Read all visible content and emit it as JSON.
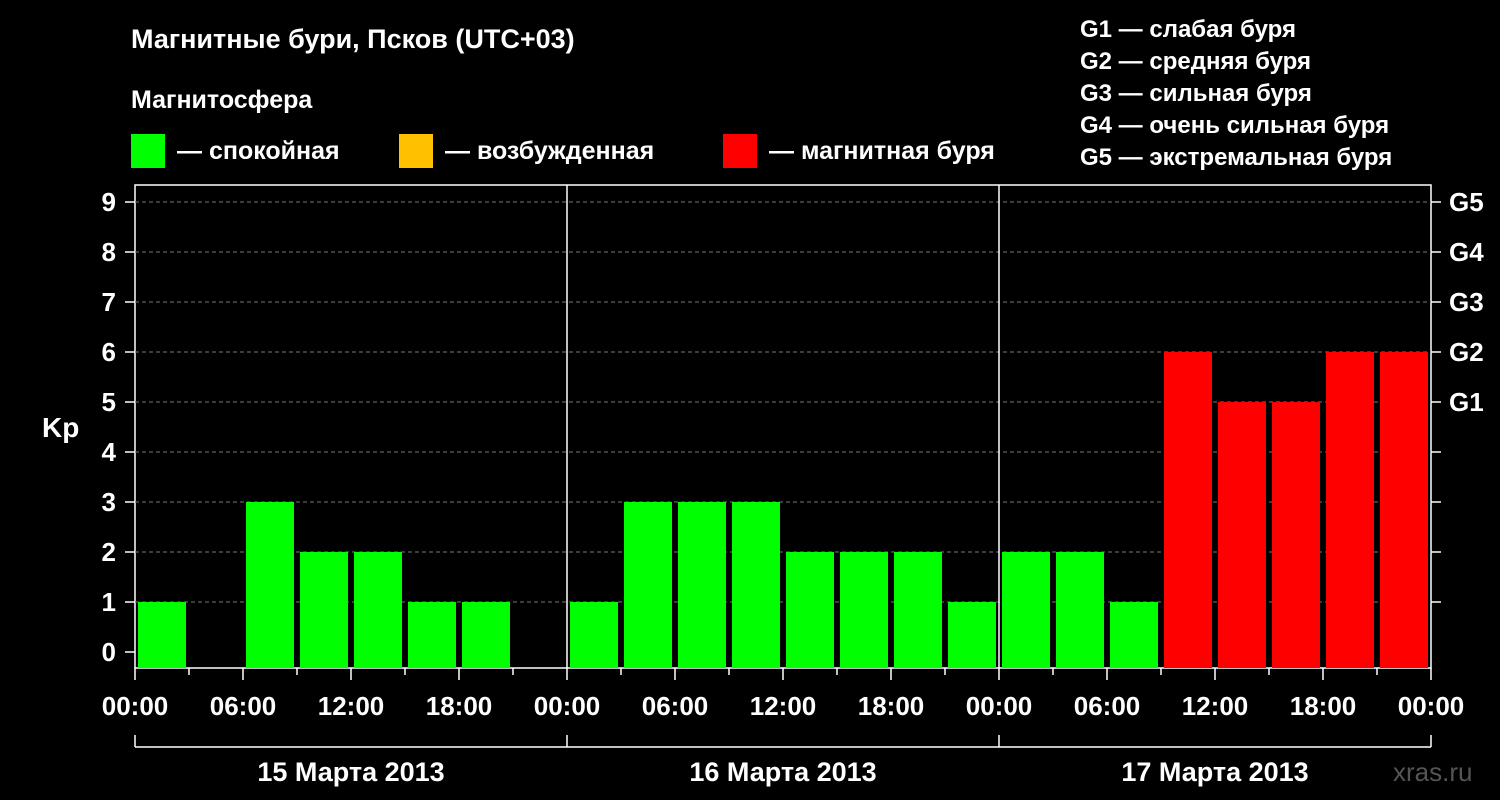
{
  "header": {
    "title": "Магнитные бури, Псков (UTC+03)",
    "subtitle": "Магнитосфера"
  },
  "legend": [
    {
      "label": "— спокойная",
      "color": "#00ff00"
    },
    {
      "label": "— возбужденная",
      "color": "#ffc000"
    },
    {
      "label": "— магнитная буря",
      "color": "#ff0000"
    }
  ],
  "g_scale": [
    "G1 — слабая буря",
    "G2 — средняя буря",
    "G3 — сильная буря",
    "G4 — очень сильная буря",
    "G5 — экстремальная буря"
  ],
  "watermark": "xras.ru",
  "chart_data": {
    "type": "bar",
    "ylabel": "Kp",
    "ylim": [
      0,
      9
    ],
    "y_ticks": [
      "0",
      "1",
      "2",
      "3",
      "4",
      "5",
      "6",
      "7",
      "8",
      "9"
    ],
    "right_ticks": [
      {
        "kp": 5,
        "label": "G1"
      },
      {
        "kp": 6,
        "label": "G2"
      },
      {
        "kp": 7,
        "label": "G3"
      },
      {
        "kp": 8,
        "label": "G4"
      },
      {
        "kp": 9,
        "label": "G5"
      }
    ],
    "x_tick_labels": [
      "00:00",
      "06:00",
      "12:00",
      "18:00",
      "00:00",
      "06:00",
      "12:00",
      "18:00",
      "00:00",
      "06:00",
      "12:00",
      "18:00",
      "00:00"
    ],
    "days": [
      "15 Марта 2013",
      "16 Марта 2013",
      "17 Марта 2013"
    ],
    "values": [
      1,
      0,
      3,
      2,
      2,
      1,
      1,
      0,
      1,
      3,
      3,
      3,
      2,
      2,
      2,
      1,
      2,
      2,
      1,
      6,
      5,
      5,
      6,
      6
    ],
    "colors": {
      "calm": "#00ff00",
      "excited": "#ffc000",
      "storm": "#ff0000"
    },
    "grid": "dashed horizontal"
  }
}
